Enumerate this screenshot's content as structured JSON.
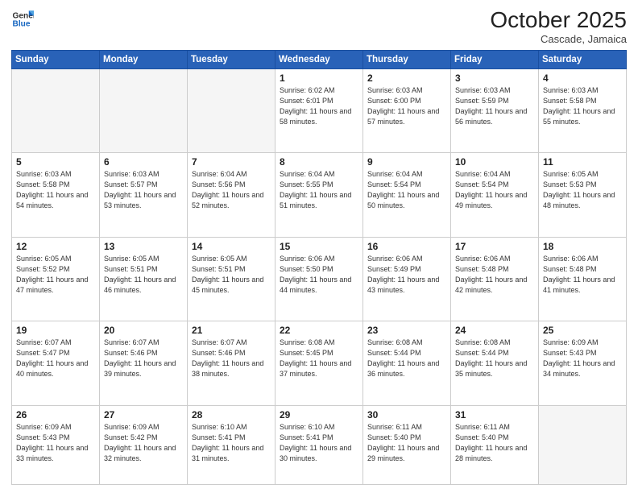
{
  "header": {
    "logo_line1": "General",
    "logo_line2": "Blue",
    "month": "October 2025",
    "location": "Cascade, Jamaica"
  },
  "days_of_week": [
    "Sunday",
    "Monday",
    "Tuesday",
    "Wednesday",
    "Thursday",
    "Friday",
    "Saturday"
  ],
  "weeks": [
    [
      {
        "day": "",
        "sunrise": "",
        "sunset": "",
        "daylight": ""
      },
      {
        "day": "",
        "sunrise": "",
        "sunset": "",
        "daylight": ""
      },
      {
        "day": "",
        "sunrise": "",
        "sunset": "",
        "daylight": ""
      },
      {
        "day": "1",
        "sunrise": "Sunrise: 6:02 AM",
        "sunset": "Sunset: 6:01 PM",
        "daylight": "Daylight: 11 hours and 58 minutes."
      },
      {
        "day": "2",
        "sunrise": "Sunrise: 6:03 AM",
        "sunset": "Sunset: 6:00 PM",
        "daylight": "Daylight: 11 hours and 57 minutes."
      },
      {
        "day": "3",
        "sunrise": "Sunrise: 6:03 AM",
        "sunset": "Sunset: 5:59 PM",
        "daylight": "Daylight: 11 hours and 56 minutes."
      },
      {
        "day": "4",
        "sunrise": "Sunrise: 6:03 AM",
        "sunset": "Sunset: 5:58 PM",
        "daylight": "Daylight: 11 hours and 55 minutes."
      }
    ],
    [
      {
        "day": "5",
        "sunrise": "Sunrise: 6:03 AM",
        "sunset": "Sunset: 5:58 PM",
        "daylight": "Daylight: 11 hours and 54 minutes."
      },
      {
        "day": "6",
        "sunrise": "Sunrise: 6:03 AM",
        "sunset": "Sunset: 5:57 PM",
        "daylight": "Daylight: 11 hours and 53 minutes."
      },
      {
        "day": "7",
        "sunrise": "Sunrise: 6:04 AM",
        "sunset": "Sunset: 5:56 PM",
        "daylight": "Daylight: 11 hours and 52 minutes."
      },
      {
        "day": "8",
        "sunrise": "Sunrise: 6:04 AM",
        "sunset": "Sunset: 5:55 PM",
        "daylight": "Daylight: 11 hours and 51 minutes."
      },
      {
        "day": "9",
        "sunrise": "Sunrise: 6:04 AM",
        "sunset": "Sunset: 5:54 PM",
        "daylight": "Daylight: 11 hours and 50 minutes."
      },
      {
        "day": "10",
        "sunrise": "Sunrise: 6:04 AM",
        "sunset": "Sunset: 5:54 PM",
        "daylight": "Daylight: 11 hours and 49 minutes."
      },
      {
        "day": "11",
        "sunrise": "Sunrise: 6:05 AM",
        "sunset": "Sunset: 5:53 PM",
        "daylight": "Daylight: 11 hours and 48 minutes."
      }
    ],
    [
      {
        "day": "12",
        "sunrise": "Sunrise: 6:05 AM",
        "sunset": "Sunset: 5:52 PM",
        "daylight": "Daylight: 11 hours and 47 minutes."
      },
      {
        "day": "13",
        "sunrise": "Sunrise: 6:05 AM",
        "sunset": "Sunset: 5:51 PM",
        "daylight": "Daylight: 11 hours and 46 minutes."
      },
      {
        "day": "14",
        "sunrise": "Sunrise: 6:05 AM",
        "sunset": "Sunset: 5:51 PM",
        "daylight": "Daylight: 11 hours and 45 minutes."
      },
      {
        "day": "15",
        "sunrise": "Sunrise: 6:06 AM",
        "sunset": "Sunset: 5:50 PM",
        "daylight": "Daylight: 11 hours and 44 minutes."
      },
      {
        "day": "16",
        "sunrise": "Sunrise: 6:06 AM",
        "sunset": "Sunset: 5:49 PM",
        "daylight": "Daylight: 11 hours and 43 minutes."
      },
      {
        "day": "17",
        "sunrise": "Sunrise: 6:06 AM",
        "sunset": "Sunset: 5:48 PM",
        "daylight": "Daylight: 11 hours and 42 minutes."
      },
      {
        "day": "18",
        "sunrise": "Sunrise: 6:06 AM",
        "sunset": "Sunset: 5:48 PM",
        "daylight": "Daylight: 11 hours and 41 minutes."
      }
    ],
    [
      {
        "day": "19",
        "sunrise": "Sunrise: 6:07 AM",
        "sunset": "Sunset: 5:47 PM",
        "daylight": "Daylight: 11 hours and 40 minutes."
      },
      {
        "day": "20",
        "sunrise": "Sunrise: 6:07 AM",
        "sunset": "Sunset: 5:46 PM",
        "daylight": "Daylight: 11 hours and 39 minutes."
      },
      {
        "day": "21",
        "sunrise": "Sunrise: 6:07 AM",
        "sunset": "Sunset: 5:46 PM",
        "daylight": "Daylight: 11 hours and 38 minutes."
      },
      {
        "day": "22",
        "sunrise": "Sunrise: 6:08 AM",
        "sunset": "Sunset: 5:45 PM",
        "daylight": "Daylight: 11 hours and 37 minutes."
      },
      {
        "day": "23",
        "sunrise": "Sunrise: 6:08 AM",
        "sunset": "Sunset: 5:44 PM",
        "daylight": "Daylight: 11 hours and 36 minutes."
      },
      {
        "day": "24",
        "sunrise": "Sunrise: 6:08 AM",
        "sunset": "Sunset: 5:44 PM",
        "daylight": "Daylight: 11 hours and 35 minutes."
      },
      {
        "day": "25",
        "sunrise": "Sunrise: 6:09 AM",
        "sunset": "Sunset: 5:43 PM",
        "daylight": "Daylight: 11 hours and 34 minutes."
      }
    ],
    [
      {
        "day": "26",
        "sunrise": "Sunrise: 6:09 AM",
        "sunset": "Sunset: 5:43 PM",
        "daylight": "Daylight: 11 hours and 33 minutes."
      },
      {
        "day": "27",
        "sunrise": "Sunrise: 6:09 AM",
        "sunset": "Sunset: 5:42 PM",
        "daylight": "Daylight: 11 hours and 32 minutes."
      },
      {
        "day": "28",
        "sunrise": "Sunrise: 6:10 AM",
        "sunset": "Sunset: 5:41 PM",
        "daylight": "Daylight: 11 hours and 31 minutes."
      },
      {
        "day": "29",
        "sunrise": "Sunrise: 6:10 AM",
        "sunset": "Sunset: 5:41 PM",
        "daylight": "Daylight: 11 hours and 30 minutes."
      },
      {
        "day": "30",
        "sunrise": "Sunrise: 6:11 AM",
        "sunset": "Sunset: 5:40 PM",
        "daylight": "Daylight: 11 hours and 29 minutes."
      },
      {
        "day": "31",
        "sunrise": "Sunrise: 6:11 AM",
        "sunset": "Sunset: 5:40 PM",
        "daylight": "Daylight: 11 hours and 28 minutes."
      },
      {
        "day": "",
        "sunrise": "",
        "sunset": "",
        "daylight": ""
      }
    ]
  ]
}
